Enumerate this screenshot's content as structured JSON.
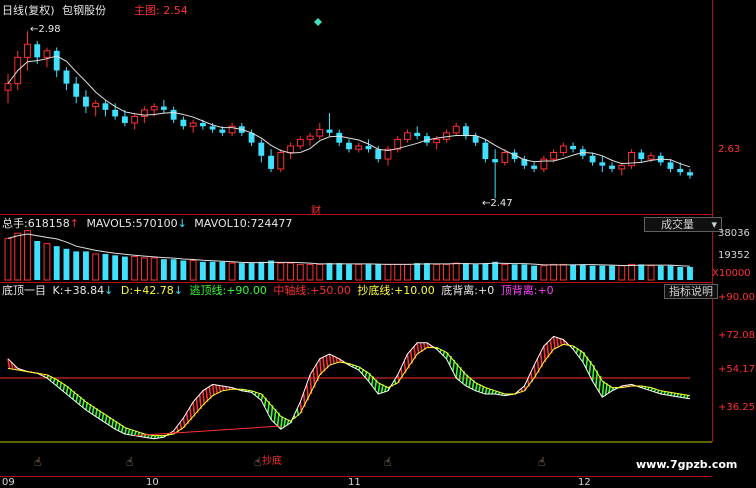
{
  "price_panel": {
    "period_label": "日线(复权)",
    "stock_name": "包钢股份",
    "indicator_name": "主图",
    "indicator_value": "2.54",
    "high_label": "2.98",
    "low_label": "2.47",
    "axis_label": "2.63",
    "event_marker": "财"
  },
  "volume_panel": {
    "total_label": "总手:",
    "total_value": "618158",
    "ma5_label": "MAVOL5:",
    "ma5_value": "570100",
    "ma10_label": "MAVOL10:",
    "ma10_value": "724477",
    "dropdown_label": "成交量",
    "axis_top": "38036",
    "axis_mid": "19352",
    "axis_unit": "X10000"
  },
  "indicator_panel": {
    "name": "底顶一目",
    "k_label": "K:",
    "k_value": "+38.84",
    "d_label": "D:",
    "d_value": "+42.78",
    "top_line_label": "逃顶线:",
    "top_line_value": "+90.00",
    "mid_line_label": "中轴线:",
    "mid_line_value": "+50.00",
    "bottom_line_label": "抄底线:",
    "bottom_line_value": "+10.00",
    "bottom_div_label": "底背离:",
    "bottom_div_value": "+0",
    "top_div_label": "顶背离:",
    "top_div_value": "+0",
    "help_button": "指标说明",
    "axis": [
      "+90.00",
      "+72.08",
      "+54.17",
      "+36.25"
    ],
    "divergence_label": "抄底"
  },
  "date_axis": [
    "09",
    "10",
    "11",
    "12"
  ],
  "watermark": "www.7gpzb.com",
  "colors": {
    "up": "#ff3030",
    "down": "#40e0ff",
    "panel_line": "#ff3030",
    "k_line": "#ffffff",
    "d_line": "#ffff33"
  },
  "chart_data": [
    {
      "type": "candlestick",
      "title": "",
      "ohlc": [
        [
          2.8,
          2.85,
          2.76,
          2.82
        ],
        [
          2.82,
          2.92,
          2.8,
          2.9
        ],
        [
          2.9,
          2.98,
          2.86,
          2.94
        ],
        [
          2.94,
          2.95,
          2.88,
          2.9
        ],
        [
          2.9,
          2.93,
          2.87,
          2.92
        ],
        [
          2.92,
          2.93,
          2.84,
          2.86
        ],
        [
          2.86,
          2.87,
          2.8,
          2.82
        ],
        [
          2.82,
          2.84,
          2.76,
          2.78
        ],
        [
          2.78,
          2.8,
          2.73,
          2.75
        ],
        [
          2.75,
          2.77,
          2.72,
          2.76
        ],
        [
          2.76,
          2.77,
          2.72,
          2.74
        ],
        [
          2.74,
          2.76,
          2.71,
          2.72
        ],
        [
          2.72,
          2.74,
          2.69,
          2.7
        ],
        [
          2.7,
          2.73,
          2.68,
          2.72
        ],
        [
          2.72,
          2.75,
          2.7,
          2.74
        ],
        [
          2.74,
          2.76,
          2.72,
          2.75
        ],
        [
          2.75,
          2.77,
          2.73,
          2.74
        ],
        [
          2.74,
          2.75,
          2.7,
          2.71
        ],
        [
          2.71,
          2.72,
          2.68,
          2.69
        ],
        [
          2.69,
          2.71,
          2.67,
          2.7
        ],
        [
          2.7,
          2.71,
          2.68,
          2.69
        ],
        [
          2.69,
          2.7,
          2.67,
          2.68
        ],
        [
          2.68,
          2.69,
          2.66,
          2.67
        ],
        [
          2.67,
          2.7,
          2.66,
          2.69
        ],
        [
          2.69,
          2.7,
          2.66,
          2.67
        ],
        [
          2.67,
          2.68,
          2.63,
          2.64
        ],
        [
          2.64,
          2.65,
          2.58,
          2.6
        ],
        [
          2.6,
          2.62,
          2.55,
          2.56
        ],
        [
          2.56,
          2.62,
          2.55,
          2.61
        ],
        [
          2.61,
          2.64,
          2.59,
          2.63
        ],
        [
          2.63,
          2.66,
          2.62,
          2.65
        ],
        [
          2.65,
          2.67,
          2.63,
          2.66
        ],
        [
          2.66,
          2.7,
          2.65,
          2.68
        ],
        [
          2.68,
          2.73,
          2.66,
          2.67
        ],
        [
          2.67,
          2.68,
          2.63,
          2.64
        ],
        [
          2.64,
          2.65,
          2.61,
          2.62
        ],
        [
          2.62,
          2.64,
          2.61,
          2.63
        ],
        [
          2.63,
          2.65,
          2.61,
          2.62
        ],
        [
          2.62,
          2.63,
          2.58,
          2.59
        ],
        [
          2.59,
          2.63,
          2.57,
          2.62
        ],
        [
          2.62,
          2.66,
          2.61,
          2.65
        ],
        [
          2.65,
          2.68,
          2.64,
          2.67
        ],
        [
          2.67,
          2.69,
          2.65,
          2.66
        ],
        [
          2.66,
          2.67,
          2.63,
          2.64
        ],
        [
          2.64,
          2.66,
          2.62,
          2.65
        ],
        [
          2.65,
          2.68,
          2.64,
          2.67
        ],
        [
          2.67,
          2.7,
          2.66,
          2.69
        ],
        [
          2.69,
          2.7,
          2.65,
          2.66
        ],
        [
          2.66,
          2.67,
          2.63,
          2.64
        ],
        [
          2.64,
          2.65,
          2.58,
          2.59
        ],
        [
          2.59,
          2.62,
          2.47,
          2.58
        ],
        [
          2.58,
          2.62,
          2.57,
          2.61
        ],
        [
          2.61,
          2.62,
          2.58,
          2.59
        ],
        [
          2.59,
          2.6,
          2.56,
          2.57
        ],
        [
          2.57,
          2.58,
          2.55,
          2.56
        ],
        [
          2.56,
          2.6,
          2.55,
          2.59
        ],
        [
          2.59,
          2.62,
          2.58,
          2.61
        ],
        [
          2.61,
          2.64,
          2.6,
          2.63
        ],
        [
          2.63,
          2.64,
          2.61,
          2.62
        ],
        [
          2.62,
          2.63,
          2.59,
          2.6
        ],
        [
          2.6,
          2.61,
          2.57,
          2.58
        ],
        [
          2.58,
          2.6,
          2.55,
          2.57
        ],
        [
          2.57,
          2.58,
          2.55,
          2.56
        ],
        [
          2.56,
          2.58,
          2.54,
          2.57
        ],
        [
          2.57,
          2.62,
          2.56,
          2.61
        ],
        [
          2.61,
          2.62,
          2.58,
          2.59
        ],
        [
          2.59,
          2.61,
          2.58,
          2.6
        ],
        [
          2.6,
          2.61,
          2.57,
          2.58
        ],
        [
          2.58,
          2.59,
          2.55,
          2.56
        ],
        [
          2.56,
          2.58,
          2.54,
          2.55
        ],
        [
          2.55,
          2.56,
          2.53,
          2.54
        ]
      ],
      "ylim": [
        2.45,
        3.02
      ]
    },
    {
      "type": "bar",
      "title": "",
      "values": [
        32,
        36,
        38,
        30,
        28,
        26,
        24,
        22,
        22,
        20,
        20,
        19,
        18,
        18,
        17,
        17,
        16,
        16,
        15,
        15,
        14,
        14,
        14,
        13,
        13,
        13,
        14,
        15,
        13,
        13,
        12,
        12,
        12,
        13,
        13,
        12,
        12,
        12,
        12,
        12,
        12,
        12,
        13,
        13,
        12,
        12,
        13,
        13,
        12,
        13,
        14,
        12,
        12,
        12,
        11,
        11,
        12,
        12,
        12,
        12,
        11,
        11,
        11,
        11,
        12,
        12,
        11,
        11,
        11,
        10,
        10
      ],
      "ylim": [
        0,
        40
      ]
    },
    {
      "type": "line",
      "title": "",
      "series": [
        {
          "name": "K",
          "values": [
            62,
            56,
            54,
            53,
            50,
            45,
            40,
            35,
            30,
            26,
            22,
            18,
            15,
            14,
            13,
            12,
            13,
            17,
            25,
            35,
            42,
            46,
            45,
            44,
            42,
            41,
            36,
            24,
            18,
            22,
            35,
            52,
            62,
            65,
            62,
            58,
            55,
            48,
            40,
            42,
            52,
            65,
            72,
            72,
            68,
            62,
            50,
            45,
            42,
            40,
            40,
            39,
            40,
            45,
            58,
            70,
            76,
            74,
            68,
            60,
            48,
            38,
            42,
            45,
            46,
            44,
            42,
            40,
            39,
            38,
            37
          ]
        },
        {
          "name": "D",
          "values": [
            56,
            55,
            54,
            53,
            52,
            49,
            45,
            40,
            35,
            31,
            27,
            23,
            19,
            17,
            15,
            14,
            14,
            15,
            19,
            26,
            33,
            39,
            42,
            43,
            43,
            42,
            40,
            33,
            26,
            23,
            28,
            40,
            52,
            58,
            60,
            59,
            57,
            53,
            47,
            44,
            47,
            56,
            65,
            69,
            69,
            66,
            59,
            52,
            47,
            44,
            42,
            40,
            40,
            42,
            50,
            60,
            68,
            71,
            70,
            66,
            58,
            48,
            44,
            44,
            45,
            45,
            44,
            42,
            41,
            40,
            39
          ]
        }
      ],
      "ylim": [
        0,
        100
      ]
    }
  ]
}
